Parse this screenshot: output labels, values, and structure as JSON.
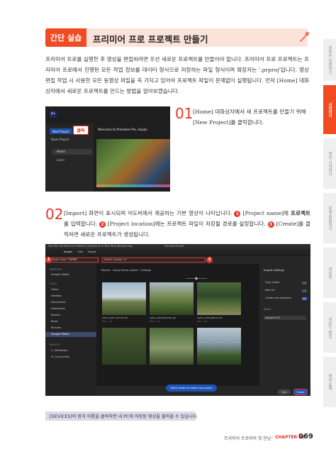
{
  "banner": {
    "tag": "간단 실습",
    "title": "프리미어 프로 프로젝트 만들기"
  },
  "intro": "프리미어 프로를 실행한 후 영상을 편집하려면 우선 새로운 프로젝트를 만들어야 합니다. 프리미어 프로 프로젝트는 프리미어 프로에서 진행된 모든 작업 정보를 데이터 형식으로 저장하는 파일 형식이며 확장자는 '.prproj'입니다. 영상 편집 작업 시 사용한 모든 동영상 파일을 꼭 가지고 있어야 프로젝트 파일이 문제없이 실행됩니다. 먼저 [Home] 대화상자에서 새로운 프로젝트를 만드는 방법을 알아보겠습니다.",
  "shot1": {
    "logo": "Pr",
    "new_project": "New Project",
    "click_tag": "클릭",
    "open_project": "Open Project",
    "home": "Home",
    "learn": "Learn",
    "welcome": "Welcome to Premiere Pro, Soojin"
  },
  "step1": {
    "num": "01",
    "text": "[Home] 대화상자에서 새 프로젝트를 만들기 위해 [New Project]를 클릭합니다."
  },
  "step2": {
    "num": "02",
    "part1": "[Import] 화면이 표시되며 어도비에서 제공하는 기본 영상이 나타납니다. ",
    "b1": "1",
    "part2": " [Project name]에 ",
    "bold1": "프로젝트",
    "part3": "를 입력합니다. ",
    "b2": "2",
    "part4": " [Project location]에는 프로젝트 파일이 저장될 경로를 설정합니다. ",
    "b3": "3",
    "part5": " [Create]를 클릭하면 새로운 프로젝트가 생성됩니다."
  },
  "shot2": {
    "menubar": "File  Edit  Clip  Sequence  Markers  Graphics and Titles  View  Window  Help",
    "window_title": "Premiere Project",
    "tabs": [
      "Import",
      "Edit",
      "Export"
    ],
    "project_name_label": "Project name",
    "project_name_value": "프로젝트",
    "project_location_label": "Project location",
    "project_location_value": "D:",
    "badges": [
      "1",
      "2",
      "3"
    ],
    "left": {
      "favorites": "FAVORITES",
      "sample_media": "Sample Media",
      "local": "LOCAL",
      "items": [
        "Home",
        "Desktop",
        "Documents",
        "Downloads",
        "Movies",
        "Music",
        "Pictures",
        "Sample Media"
      ],
      "devices": "DEVICES",
      "device_items": [
        "C: (Windows)",
        "D: (Local Disk)"
      ]
    },
    "path": "Tutorial  ›  Going Home project  ›  Footage",
    "thumbs": [
      {
        "name": "AAEG_C007_220701_R9",
        "dur": "00:1.. 4:4"
      },
      {
        "name": "AAEG_C004_BFLFWC_R9",
        "dur": "00:1.. 4:4"
      },
      {
        "name": "AAEG_C005_R8ILCR_S9",
        "dur": "00:1.. 4:4"
      }
    ],
    "right": {
      "title": "Import settings",
      "copy_media": "Copy media",
      "new_bin": "New bin",
      "create_sequence": "Create new sequence",
      "name": "Name",
      "sequence": "Sequence 01"
    },
    "select_media": "Select media to create new project",
    "exit": "Exit",
    "create": "Create"
  },
  "note": "[DEVICES]의 장치 이름을 클릭하면 내 PC에 저장된 영상을 불러올 수 있습니다.",
  "footer": {
    "book": "프리미어 프로와의 첫 만남",
    "chapter": "CHAPTER 02",
    "page": "069"
  },
  "sidetabs": [
    "유튜브 입문하기",
    "시작하기",
    "영상 시작하기",
    "유형 편집하기",
    "색보정",
    "사운드 편집",
    "영상 출력"
  ],
  "colors": {
    "accent": "#f04b23",
    "banner_bg": "#fbe3da",
    "note_bg": "#dcd8ec"
  }
}
